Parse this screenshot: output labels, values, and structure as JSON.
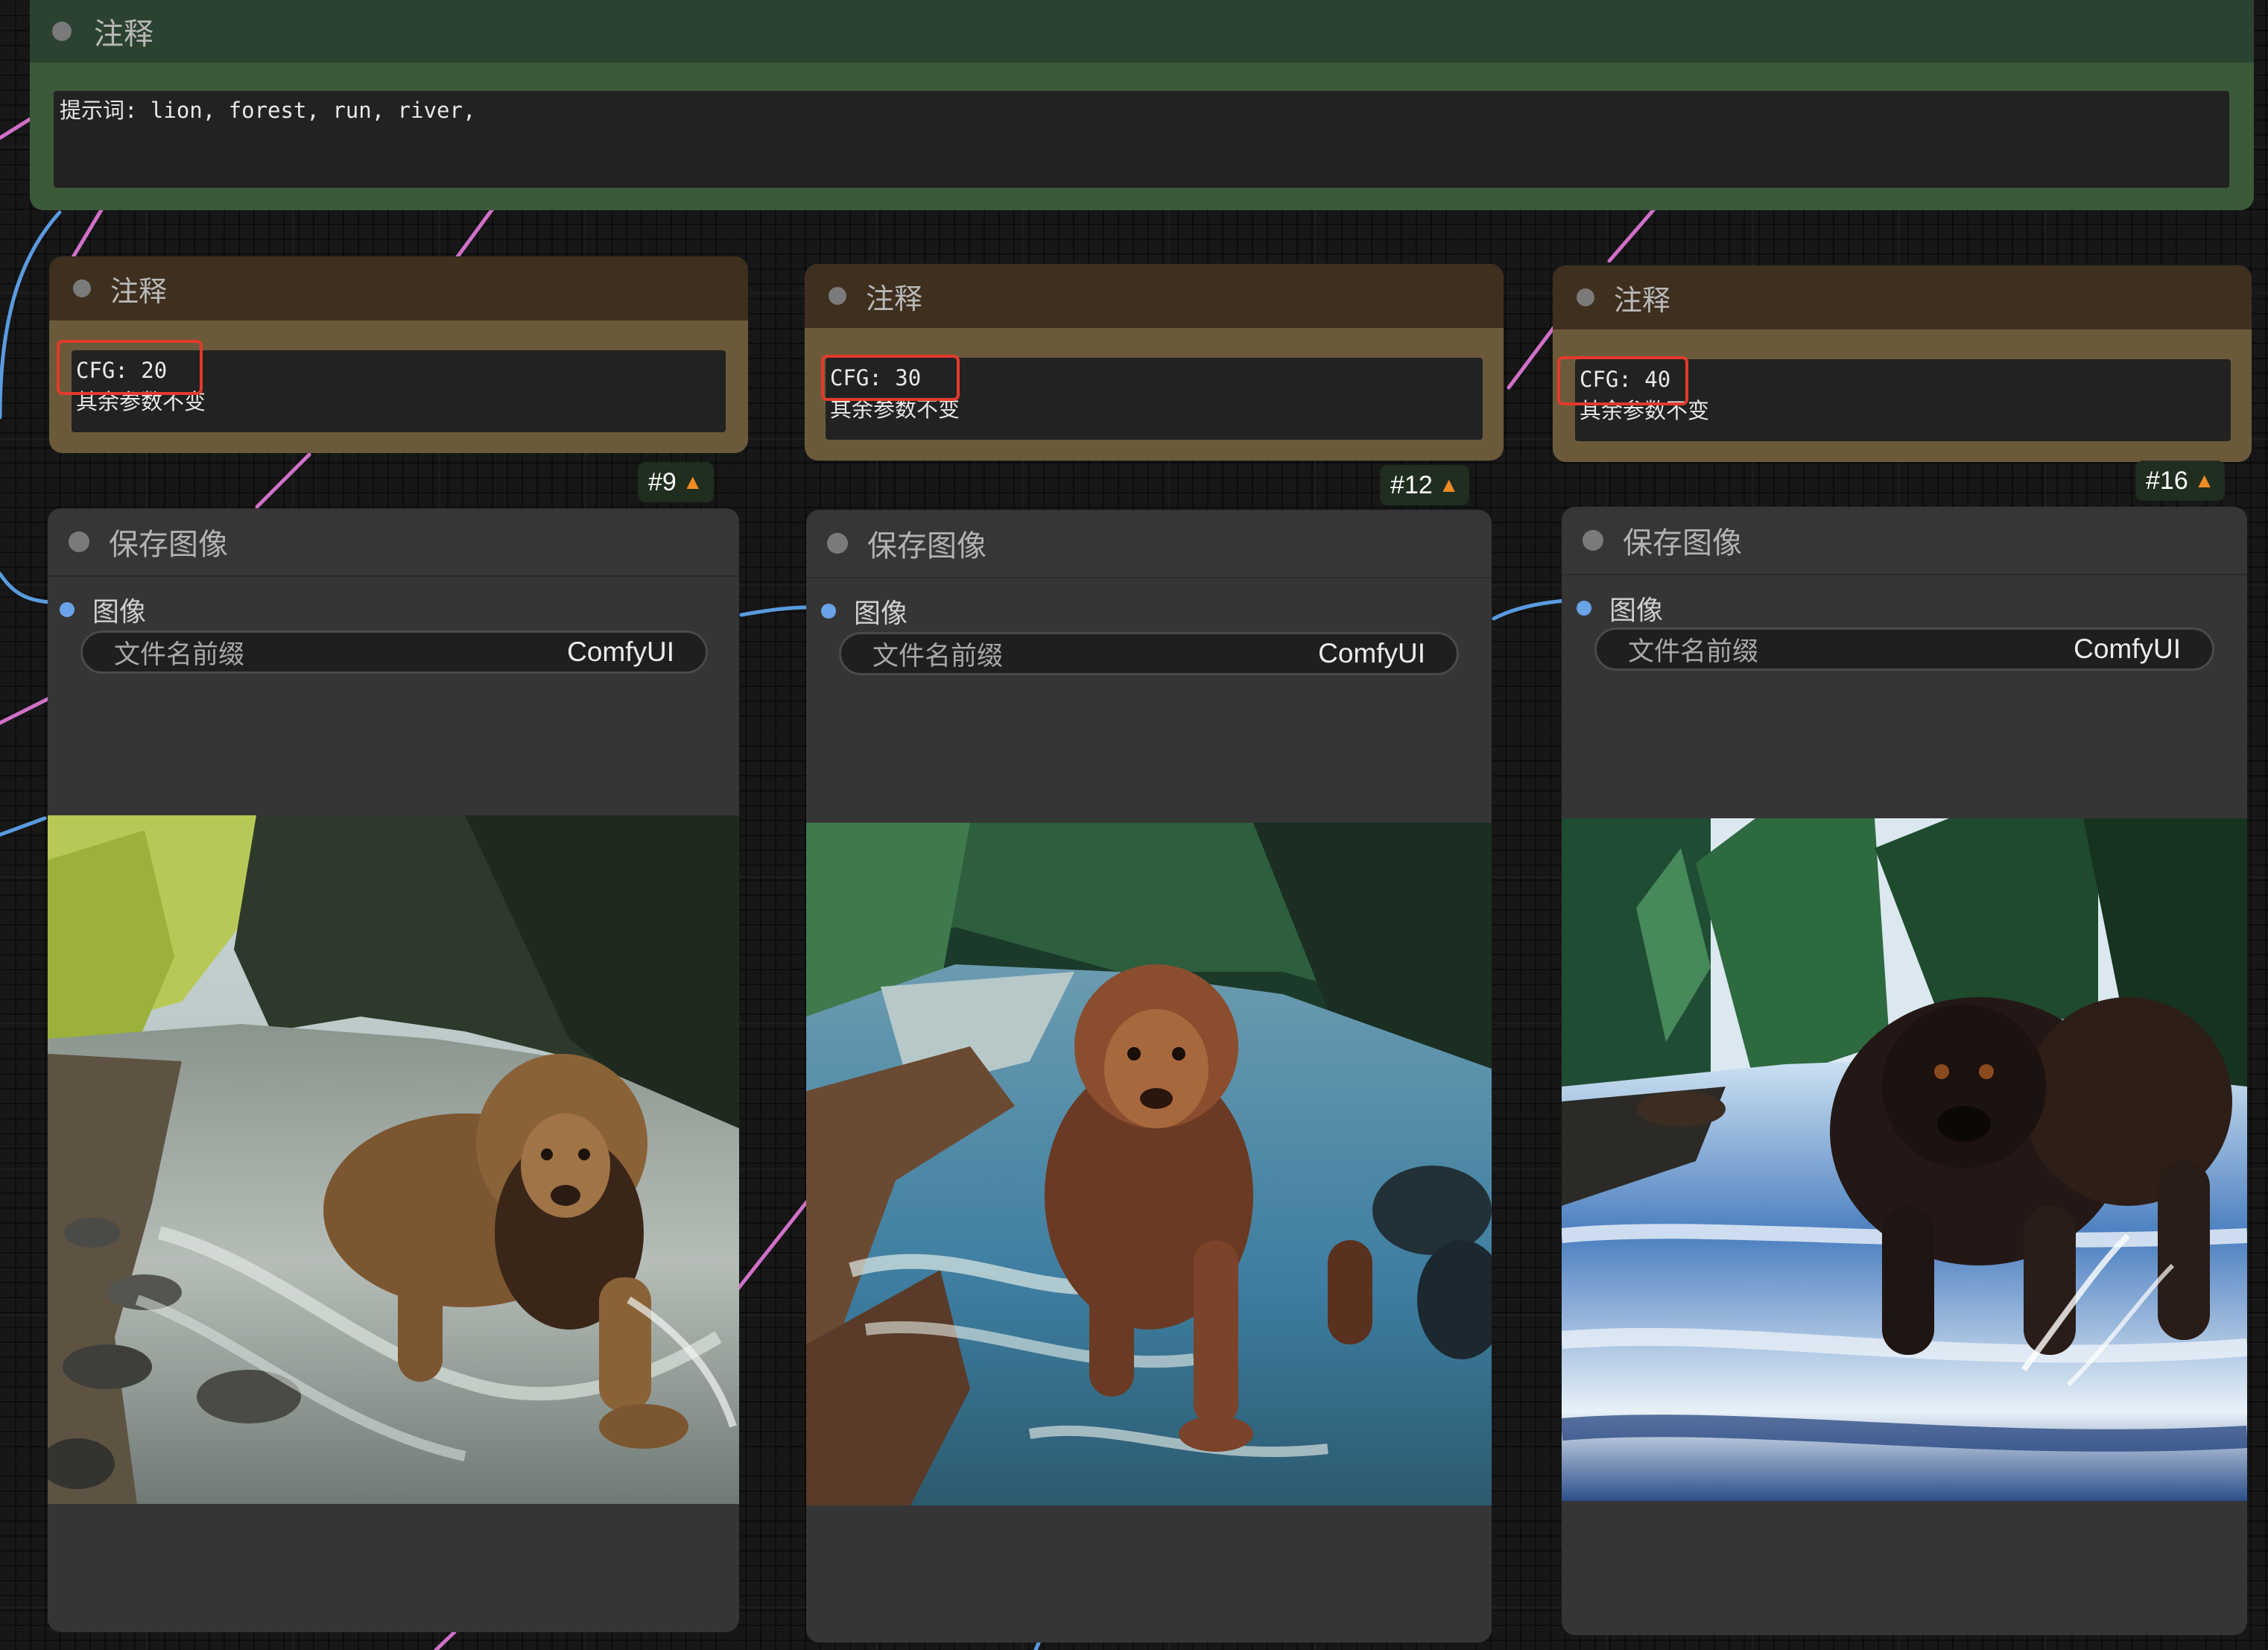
{
  "top_note": {
    "title": "注释",
    "text": "提示词: lion, forest, run, river,",
    "title_color": "#3a5a3a",
    "body_color": "#3a5a3a"
  },
  "cfg_notes": [
    {
      "title": "注释",
      "cfg_text": "CFG: 20",
      "rest_text": "其余参数不变",
      "node_id": "#9"
    },
    {
      "title": "注释",
      "cfg_text": "CFG: 30",
      "rest_text": "其余参数不变",
      "node_id": "#12"
    },
    {
      "title": "注释",
      "cfg_text": "CFG: 40",
      "rest_text": "其余参数不变",
      "node_id": "#16"
    }
  ],
  "save_nodes": [
    {
      "title": "保存图像",
      "input_label": "图像",
      "widget_label": "文件名前缀",
      "widget_value": "ComfyUI",
      "image_alt": "lion running through forest river",
      "image_style": "photoreal"
    },
    {
      "title": "保存图像",
      "input_label": "图像",
      "widget_label": "文件名前缀",
      "widget_value": "ComfyUI",
      "image_alt": "lion running through forest river",
      "image_style": "saturated"
    },
    {
      "title": "保存图像",
      "input_label": "图像",
      "widget_label": "文件名前缀",
      "widget_value": "ComfyUI",
      "image_alt": "dark bear-like beast running through forest river",
      "image_style": "overcooked"
    }
  ],
  "icons": {
    "node_dot": "circle-dot",
    "badge_icon": "fox-icon",
    "input_dot": "image-input-dot"
  },
  "colors": {
    "canvas_bg": "#171717",
    "note_title_bg": "#3e2f1f",
    "note_body_bg": "#6b5a3a",
    "save_node_bg": "#353535",
    "highlight_box": "#e23a2c",
    "link_pink": "#e57bd6",
    "link_blue": "#6aa3e8"
  }
}
